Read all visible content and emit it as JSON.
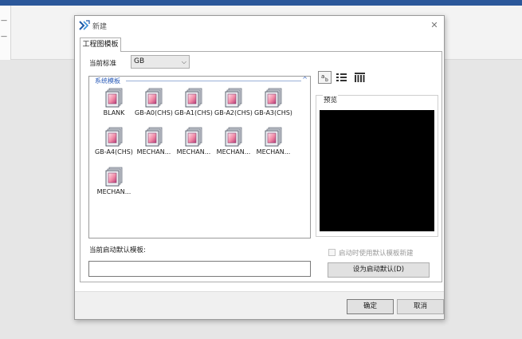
{
  "app": {
    "left_strip_marks": [
      "—",
      "—"
    ]
  },
  "dialog": {
    "title": "新建",
    "close_icon": "close-icon",
    "tab_label": "工程图模板",
    "standard": {
      "label": "当前标准",
      "value": "GB"
    },
    "templates": {
      "group_label": "系统模板",
      "collapse_icon": "chevron-up-icon",
      "items": [
        {
          "label": "BLANK"
        },
        {
          "label": "GB-A0(CHS)"
        },
        {
          "label": "GB-A1(CHS)"
        },
        {
          "label": "GB-A2(CHS)"
        },
        {
          "label": "GB-A3(CHS)"
        },
        {
          "label": "GB-A4(CHS)"
        },
        {
          "label": "MECHAN..."
        },
        {
          "label": "MECHAN..."
        },
        {
          "label": "MECHAN..."
        },
        {
          "label": "MECHAN..."
        },
        {
          "label": "MECHAN..."
        }
      ]
    },
    "view_buttons": [
      "large-icons-view",
      "list-view",
      "details-view"
    ],
    "preview_label": "预览",
    "default_template_label": "当前启动默认模板:",
    "default_template_value": "",
    "use_default_checkbox": {
      "label": "启动时使用默认模板新建",
      "checked": false,
      "enabled": false
    },
    "set_default_button": "设为启动默认(D)",
    "ok_button": "确定",
    "cancel_button": "取消"
  },
  "colors": {
    "accent": "#2b579a",
    "group_label": "#2a5bb8",
    "preview_bg": "#000000"
  }
}
